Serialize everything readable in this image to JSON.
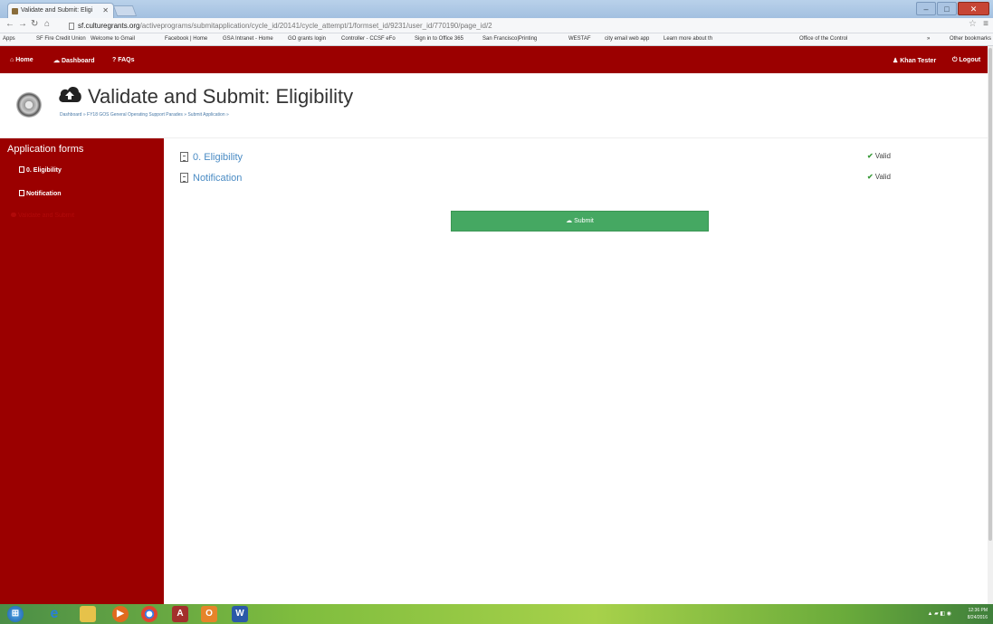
{
  "browser": {
    "tab_title": "Validate and Submit: Eligi",
    "url_host": "sf.culturegrants.org",
    "url_path": "/activeprograms/submitapplication/cycle_id/20141/cycle_attempt/1/formset_id/9231/user_id/770190/page_id/2",
    "bookmarks": [
      "Apps",
      "SF Fire Credit Union",
      "Welcome to Gmail",
      "Facebook | Home",
      "GSA Intranet - Home",
      "GO grants login",
      "Controller - CCSF eFo",
      "Sign in to Office 365",
      "San Francisco|Printing",
      "WESTAF",
      "city email web app",
      "Learn more about th",
      "Office of the Control"
    ],
    "other_bookmarks": "Other bookmarks",
    "overflow": "»"
  },
  "navbar": {
    "home": "Home",
    "dashboard": "Dashboard",
    "faqs": "FAQs",
    "user": "Khan Tester",
    "logout": "Logout"
  },
  "header": {
    "title": "Validate and Submit: Eligibility",
    "breadcrumb": "Dashboard » FY18 GOS General Operating Support Parades » Submit Application »"
  },
  "sidebar": {
    "title": "Application forms",
    "items": [
      {
        "label": "0. Eligibility"
      },
      {
        "label": "Notification"
      },
      {
        "label": "Validate and Submit"
      }
    ]
  },
  "main": {
    "forms": [
      {
        "label": "0. Eligibility",
        "status": "Valid"
      },
      {
        "label": "Notification",
        "status": "Valid"
      }
    ],
    "submit_label": "Submit"
  },
  "taskbar": {
    "time": "12:36 PM",
    "date": "8/24/2016"
  }
}
